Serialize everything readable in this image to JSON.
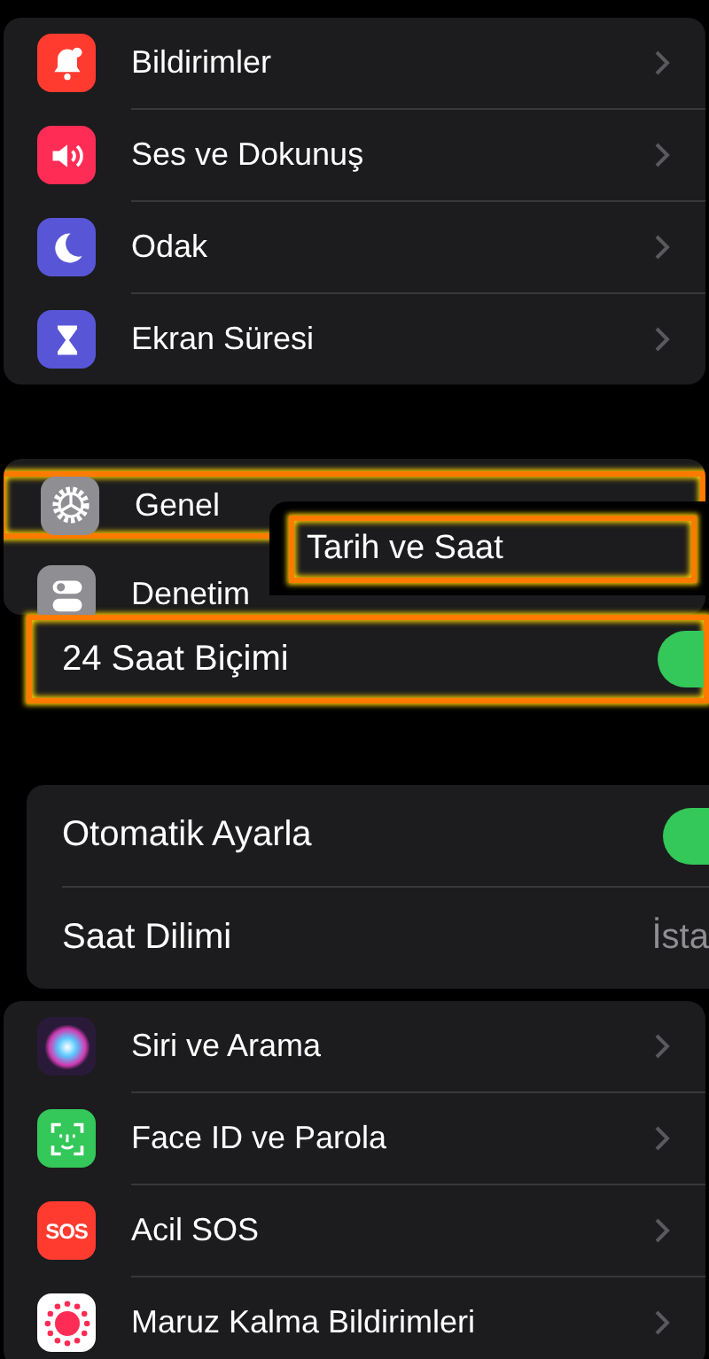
{
  "top_group": [
    {
      "label": "Bildirimler",
      "kind": "bell",
      "color": "#ff3b30"
    },
    {
      "label": "Ses ve Dokunuş",
      "kind": "speaker",
      "color": "#ff2d55"
    },
    {
      "label": "Odak",
      "kind": "moon",
      "color": "#5856d6"
    },
    {
      "label": "Ekran Süresi",
      "kind": "hourglass",
      "color": "#5856d6"
    }
  ],
  "general_group": [
    {
      "label": "Genel",
      "kind": "gear",
      "color": "#8e8e93",
      "highlighted": true
    },
    {
      "label": "Denetim",
      "kind": "switches",
      "color": "#8e8e93",
      "highlighted": false
    }
  ],
  "submenu": {
    "label": "Tarih ve Saat",
    "highlighted": true
  },
  "format_row": {
    "label": "24 Saat Biçimi",
    "on": true,
    "highlighted": true
  },
  "time_settings": [
    {
      "kind": "toggle",
      "label": "Otomatik Ayarla",
      "on": true
    },
    {
      "kind": "value",
      "label": "Saat Dilimi",
      "value": "İsta"
    }
  ],
  "bottom_group": [
    {
      "label": "Siri ve Arama",
      "kind": "orb",
      "color": "#2a1a3a"
    },
    {
      "label": "Face ID ve Parola",
      "kind": "faceid",
      "color": "#34c759"
    },
    {
      "label": "Acil SOS",
      "kind": "sos",
      "icon_text": "SOS",
      "color": "#ff3b30"
    },
    {
      "label": "Maruz Kalma Bildirimleri",
      "kind": "exposure",
      "color": "#ffffff"
    }
  ]
}
